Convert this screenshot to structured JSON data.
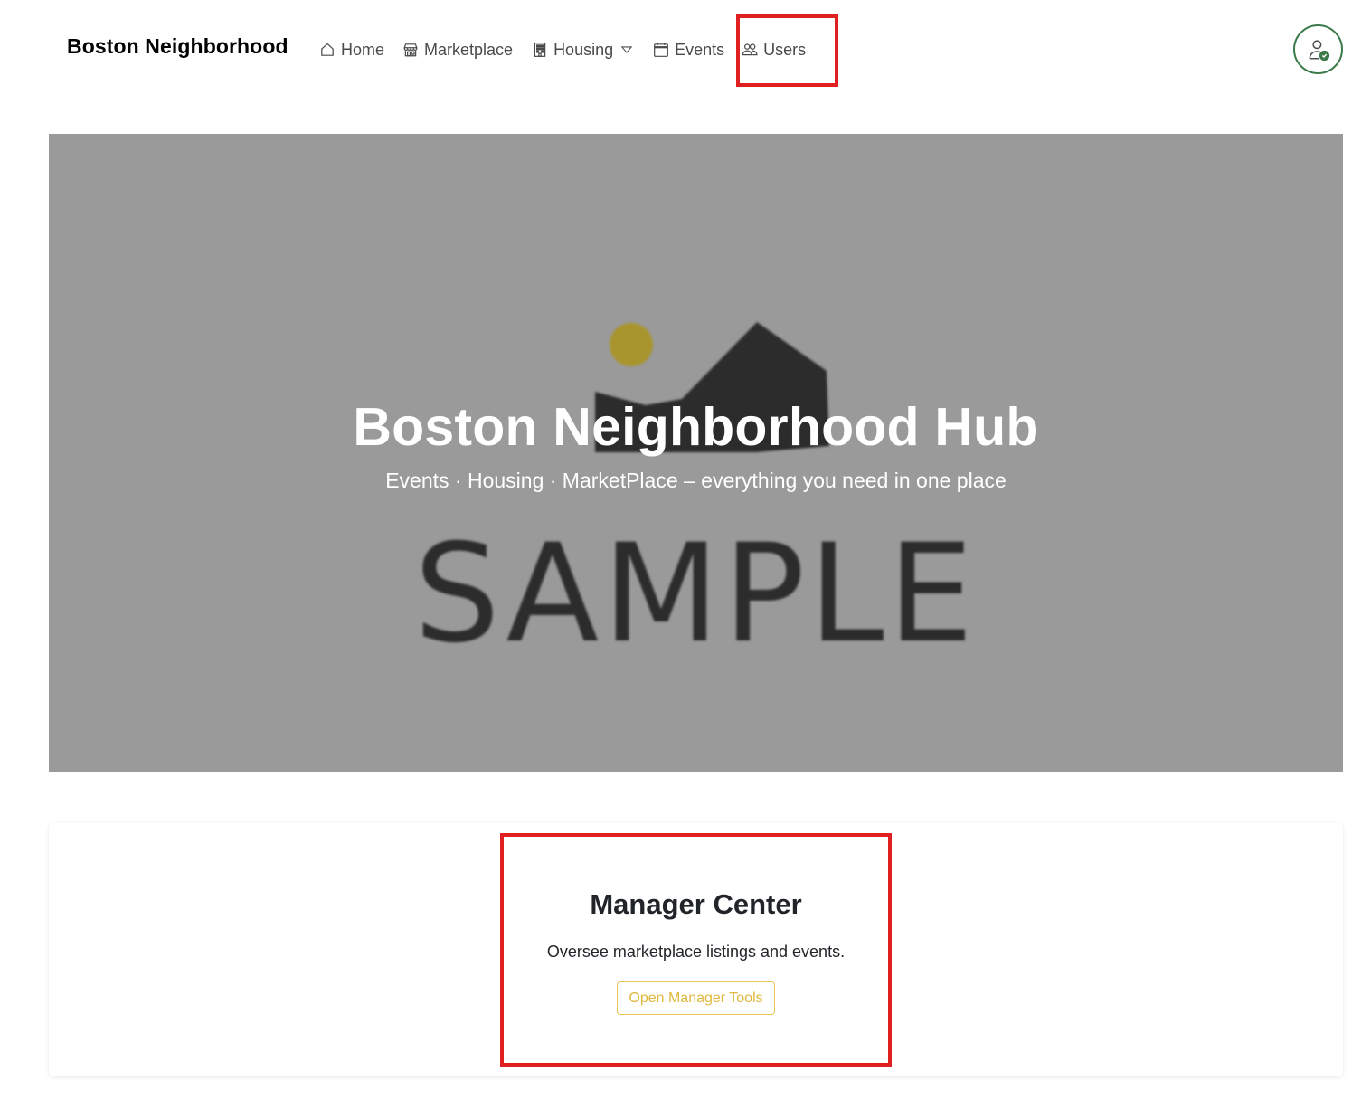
{
  "navbar": {
    "brand": "Boston Neighborhood",
    "items": [
      {
        "label": "Home",
        "icon": "home-icon"
      },
      {
        "label": "Marketplace",
        "icon": "shop-icon"
      },
      {
        "label": "Housing",
        "icon": "building-icon",
        "dropdown": true
      },
      {
        "label": "Events",
        "icon": "calendar-icon"
      },
      {
        "label": "Users",
        "icon": "people-icon"
      }
    ],
    "avatar_icon": "user-check-icon"
  },
  "hero": {
    "title": "Boston Neighborhood Hub",
    "subtitle": "Events · Housing · MarketPlace – everything you need in one place",
    "placeholder_text": "SAMPLE",
    "background_color": "#9a9a9a"
  },
  "manager_card": {
    "title": "Manager Center",
    "text": "Oversee marketplace listings and events.",
    "button_label": "Open Manager Tools"
  },
  "colors": {
    "accent_green": "#3d7a4a",
    "button_yellow": "#e0b83e",
    "highlight_red": "#e02020"
  }
}
